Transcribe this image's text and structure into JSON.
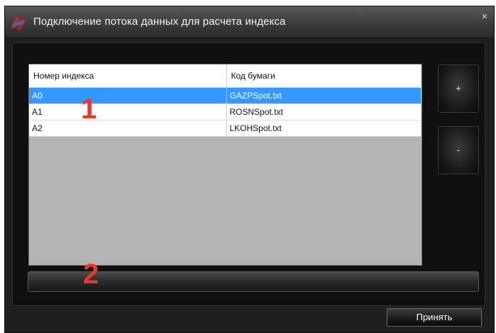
{
  "window": {
    "title": "Подключение потока данных для расчета индекса",
    "close_glyph": "×"
  },
  "table": {
    "columns": [
      "Номер индекса",
      "Код бумаги"
    ],
    "rows": [
      {
        "index": "A0",
        "code": "GAZPSpot.txt",
        "selected": true
      },
      {
        "index": "A1",
        "code": "ROSNSpot.txt",
        "selected": false
      },
      {
        "index": "A2",
        "code": "LKOHSpot.txt",
        "selected": false
      }
    ]
  },
  "buttons": {
    "add_label": "+",
    "remove_label": "-",
    "accept_label": "Принять"
  },
  "annotations": {
    "marker_1": "1",
    "marker_2": "2",
    "color": "#e8392d"
  },
  "colors": {
    "selection": "#3399ff",
    "window_bg": "#1f1f1f"
  }
}
